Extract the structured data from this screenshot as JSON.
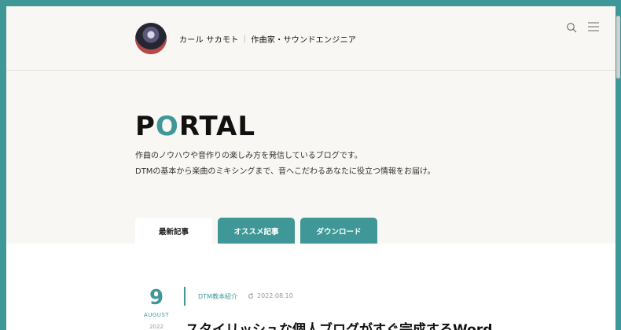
{
  "header": {
    "author": "カール サカモト",
    "role": "作曲家・サウンドエンジニア",
    "separator": "|"
  },
  "hero": {
    "logo_before": "P",
    "logo_o": "O",
    "logo_after": "RTAL",
    "desc_line1": "作曲のノウハウや音作りの楽しみ方を発信しているブログです。",
    "desc_line2": "DTMの基本から楽曲のミキシングまで、音へこだわるあなたに役立つ情報をお届け。"
  },
  "tabs": [
    {
      "label": "最新記事",
      "active": true
    },
    {
      "label": "オススメ記事",
      "active": false
    },
    {
      "label": "ダウンロード",
      "active": false
    }
  ],
  "post": {
    "day": "9",
    "month": "AUGUST",
    "year": "2022",
    "category": "DTM教本紹介",
    "updated": "2022.08.10",
    "title": "スタイリッシュな個人ブログがすぐ完成するWord"
  },
  "colors": {
    "accent": "#3f9797",
    "background": "#f8f7f3"
  },
  "icons": {
    "search": "search-icon",
    "menu": "hamburger-menu-icon",
    "updated": "refresh-icon"
  }
}
